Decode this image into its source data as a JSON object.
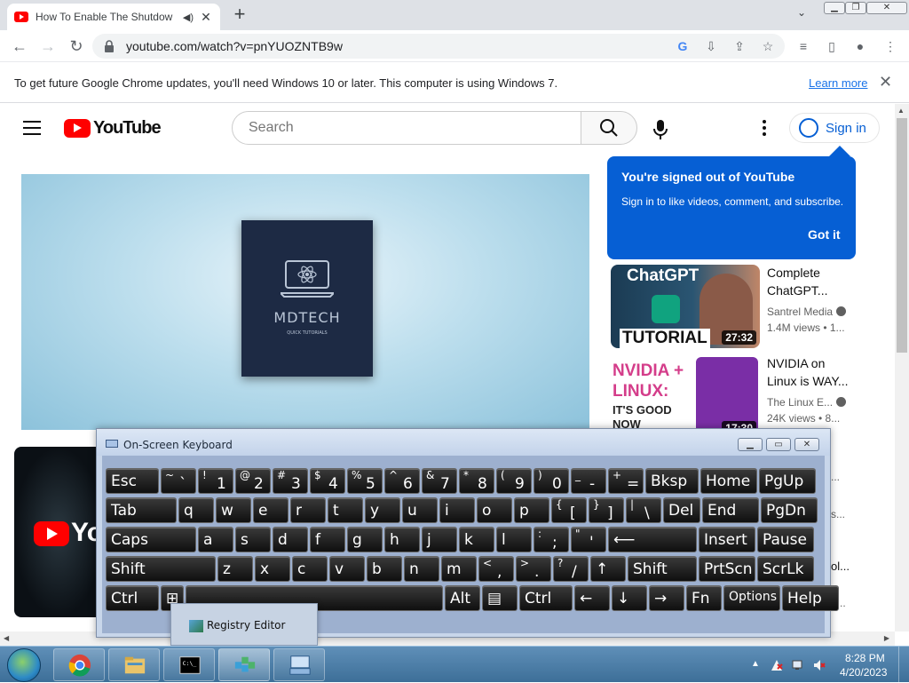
{
  "browser": {
    "tab_title": "How To Enable The Shutdow",
    "tab_audio_icon": "speaker-icon",
    "url": "youtube.com/watch?v=pnYUOZNTB9w",
    "infobar_text": "To get future Google Chrome updates, you'll need Windows 10 or later. This computer is using Windows 7.",
    "infobar_link": "Learn more"
  },
  "youtube": {
    "logo_text": "YouTube",
    "search_placeholder": "Search",
    "signin_label": "Sign in",
    "popup": {
      "title": "You're signed out of YouTube",
      "body": "Sign in to like videos, comment, and subscribe.",
      "button": "Got it"
    },
    "video_card": {
      "brand": "MDTECH",
      "tagline": "QUICK TUTORIALS"
    },
    "left_thumb_text": "You",
    "recommendations": [
      {
        "thumb_text_top": "ChatGPT",
        "thumb_text_bottom": "TUTORIAL",
        "duration": "27:32",
        "title_line1": "Complete",
        "title_line2": "ChatGPT...",
        "channel": "Santrel Media",
        "meta": "1.4M views  • 1..."
      },
      {
        "thumb_text_top": "NVIDIA + LINUX:",
        "thumb_text_bottom": "IT'S GOOD NOW",
        "duration": "17:30",
        "title_line1": "NVIDIA on",
        "title_line2": "Linux is WAY...",
        "channel": "The Linux E...",
        "meta": "24K views  • 8..."
      }
    ],
    "hidden_fragments": [
      "...",
      "s...",
      "ol...",
      "1..."
    ]
  },
  "osk": {
    "title": "On-Screen Keyboard",
    "rows": [
      [
        {
          "name": "esc",
          "label": "Esc"
        },
        {
          "name": "backtick",
          "sec": "~",
          "pri": "`"
        },
        {
          "name": "1",
          "sec": "!",
          "pri": "1"
        },
        {
          "name": "2",
          "sec": "@",
          "pri": "2"
        },
        {
          "name": "3",
          "sec": "#",
          "pri": "3"
        },
        {
          "name": "4",
          "sec": "$",
          "pri": "4"
        },
        {
          "name": "5",
          "sec": "%",
          "pri": "5"
        },
        {
          "name": "6",
          "sec": "^",
          "pri": "6"
        },
        {
          "name": "7",
          "sec": "&",
          "pri": "7"
        },
        {
          "name": "8",
          "sec": "*",
          "pri": "8"
        },
        {
          "name": "9",
          "sec": "(",
          "pri": "9"
        },
        {
          "name": "0",
          "sec": ")",
          "pri": "0"
        },
        {
          "name": "minus",
          "sec": "_",
          "pri": "-"
        },
        {
          "name": "equals",
          "sec": "+",
          "pri": "="
        },
        {
          "name": "bksp",
          "label": "Bksp"
        },
        {
          "name": "home",
          "label": "Home"
        },
        {
          "name": "pgup",
          "label": "PgUp"
        }
      ],
      [
        {
          "name": "tab",
          "label": "Tab"
        },
        {
          "name": "q",
          "label": "q"
        },
        {
          "name": "w",
          "label": "w"
        },
        {
          "name": "e",
          "label": "e"
        },
        {
          "name": "r",
          "label": "r"
        },
        {
          "name": "t",
          "label": "t"
        },
        {
          "name": "y",
          "label": "y"
        },
        {
          "name": "u",
          "label": "u"
        },
        {
          "name": "i",
          "label": "i"
        },
        {
          "name": "o",
          "label": "o"
        },
        {
          "name": "p",
          "label": "p"
        },
        {
          "name": "lbracket",
          "sec": "{",
          "pri": "["
        },
        {
          "name": "rbracket",
          "sec": "}",
          "pri": "]"
        },
        {
          "name": "backslash",
          "sec": "|",
          "pri": "\\"
        },
        {
          "name": "del",
          "label": "Del"
        },
        {
          "name": "end",
          "label": "End"
        },
        {
          "name": "pgdn",
          "label": "PgDn"
        }
      ],
      [
        {
          "name": "caps",
          "label": "Caps"
        },
        {
          "name": "a",
          "label": "a"
        },
        {
          "name": "s",
          "label": "s"
        },
        {
          "name": "d",
          "label": "d"
        },
        {
          "name": "f",
          "label": "f"
        },
        {
          "name": "g",
          "label": "g"
        },
        {
          "name": "h",
          "label": "h"
        },
        {
          "name": "j",
          "label": "j"
        },
        {
          "name": "k",
          "label": "k"
        },
        {
          "name": "l",
          "label": "l"
        },
        {
          "name": "semicolon",
          "sec": ":",
          "pri": ";"
        },
        {
          "name": "quote",
          "sec": "\"",
          "pri": "'"
        },
        {
          "name": "enter",
          "label": "⟵"
        },
        {
          "name": "insert",
          "label": "Insert"
        },
        {
          "name": "pause",
          "label": "Pause"
        }
      ],
      [
        {
          "name": "lshift",
          "label": "Shift"
        },
        {
          "name": "z",
          "label": "z"
        },
        {
          "name": "x",
          "label": "x"
        },
        {
          "name": "c",
          "label": "c"
        },
        {
          "name": "v",
          "label": "v"
        },
        {
          "name": "b",
          "label": "b"
        },
        {
          "name": "n",
          "label": "n"
        },
        {
          "name": "m",
          "label": "m"
        },
        {
          "name": "comma",
          "sec": "<",
          "pri": ","
        },
        {
          "name": "period",
          "sec": ">",
          "pri": "."
        },
        {
          "name": "slash",
          "sec": "?",
          "pri": "/"
        },
        {
          "name": "up",
          "label": "↑"
        },
        {
          "name": "rshift",
          "label": "Shift"
        },
        {
          "name": "prtscn",
          "label": "PrtScn"
        },
        {
          "name": "scrlk",
          "label": "ScrLk"
        }
      ],
      [
        {
          "name": "lctrl",
          "label": "Ctrl"
        },
        {
          "name": "win",
          "label": "⊞"
        },
        {
          "name": "space",
          "label": ""
        },
        {
          "name": "alt",
          "label": "Alt"
        },
        {
          "name": "menu",
          "label": "▤"
        },
        {
          "name": "rctrl",
          "label": "Ctrl"
        },
        {
          "name": "left",
          "label": "←"
        },
        {
          "name": "down",
          "label": "↓"
        },
        {
          "name": "right",
          "label": "→"
        },
        {
          "name": "fn",
          "label": "Fn"
        },
        {
          "name": "options",
          "label": "Options"
        },
        {
          "name": "help",
          "label": "Help"
        }
      ]
    ]
  },
  "taskbar": {
    "popup_label": "Registry Editor",
    "time": "8:28 PM",
    "date": "4/20/2023",
    "apps": [
      "chrome-icon",
      "explorer-icon",
      "cmd-icon",
      "regedit-icon",
      "osk-icon"
    ]
  }
}
